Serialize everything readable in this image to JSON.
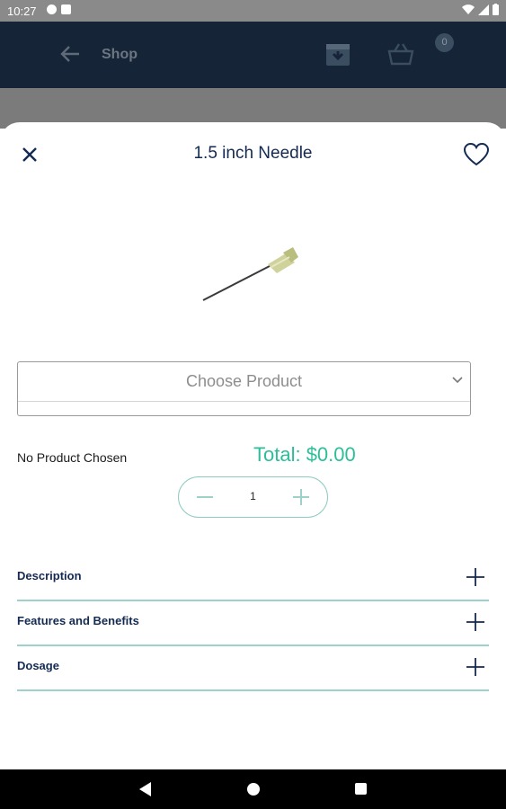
{
  "status_bar": {
    "time": "10:27"
  },
  "app_bar": {
    "title": "Shop",
    "cart_count": "0"
  },
  "sheet": {
    "title": "1.5 inch Needle",
    "select": {
      "value": "Choose Product"
    },
    "selected_product": "No Product Chosen",
    "total": "Total: $0.00",
    "quantity": "1",
    "sections": [
      {
        "label": "Description"
      },
      {
        "label": "Features and Benefits"
      },
      {
        "label": "Dosage"
      }
    ]
  },
  "colors": {
    "accent": "#2ebd9a",
    "navy": "#142a52",
    "divider": "#9fd1cb"
  },
  "icons": {
    "close": "close-icon",
    "favorite": "heart-icon",
    "expand": "plus-icon",
    "quantity_minus": "minus-icon",
    "quantity_plus": "plus-icon"
  }
}
